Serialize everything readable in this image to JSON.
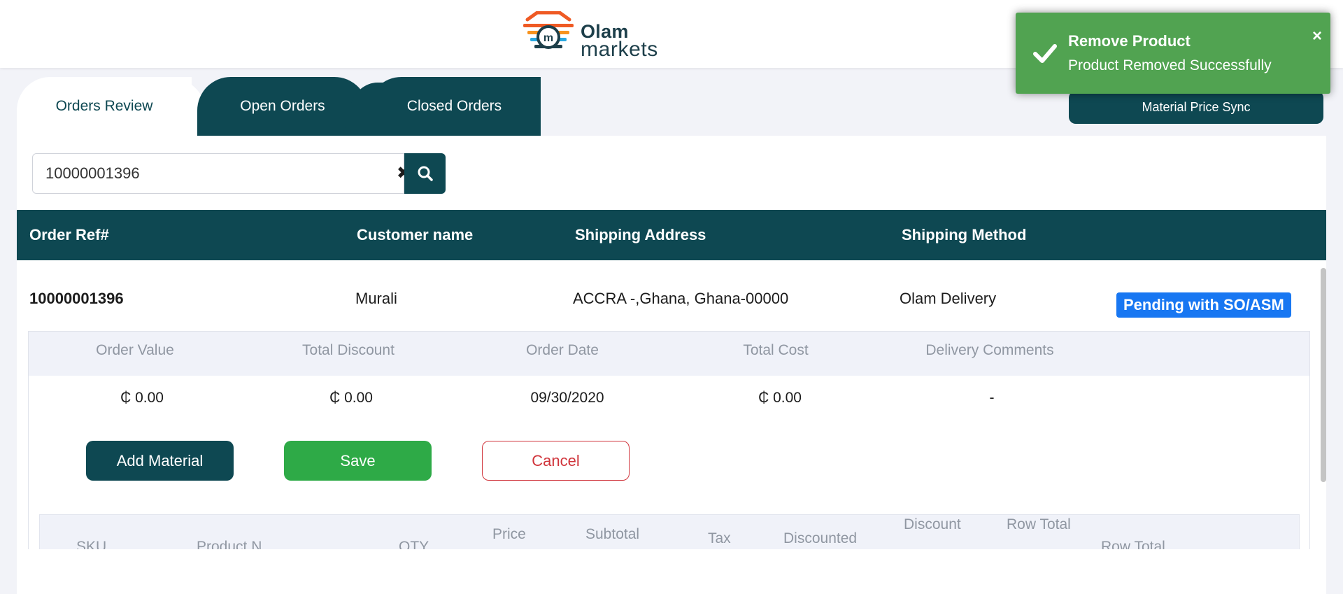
{
  "header": {
    "brand_line1": "Olam",
    "brand_line2": "markets"
  },
  "toast": {
    "title": "Remove Product",
    "message": "Product Removed Successfully",
    "close_glyph": "×",
    "color": "#51a351"
  },
  "tabs": [
    {
      "label": "Orders Review",
      "active": true
    },
    {
      "label": "Open Orders",
      "active": false
    },
    {
      "label": "Closed Orders",
      "active": false
    }
  ],
  "sync_button": "Material Price Sync",
  "search": {
    "value": "10000001396",
    "clear_glyph": "✖"
  },
  "table": {
    "headers": {
      "order_ref": "Order Ref#",
      "customer": "Customer name",
      "address": "Shipping Address",
      "method": "Shipping Method"
    },
    "row": {
      "order_ref": "10000001396",
      "customer": "Murali",
      "address": "ACCRA -,Ghana, Ghana-00000",
      "method": "Olam Delivery",
      "status": "Pending with SO/ASM"
    }
  },
  "details": {
    "headers": {
      "order_value": "Order Value",
      "total_discount": "Total Discount",
      "order_date": "Order Date",
      "total_cost": "Total Cost",
      "delivery_comments": "Delivery Comments"
    },
    "values": {
      "order_value": "₵ 0.00",
      "total_discount": "₵ 0.00",
      "order_date": "09/30/2020",
      "total_cost": "₵ 0.00",
      "delivery_comments": "-"
    },
    "buttons": {
      "add": "Add Material",
      "save": "Save",
      "cancel": "Cancel"
    }
  },
  "items_table": {
    "headers": {
      "sku": "SKU",
      "product_name": "Product N",
      "qty": "QTY",
      "price": "Price",
      "subtotal": "Subtotal",
      "tax": "Tax",
      "discounted": "Discounted",
      "discount": "Discount",
      "row_total": "Row Total",
      "row_total_2": "Row Total"
    }
  },
  "colors": {
    "primary": "#0e4852",
    "success": "#2eaa47",
    "danger": "#d0343b",
    "status_badge": "#1877f2"
  }
}
